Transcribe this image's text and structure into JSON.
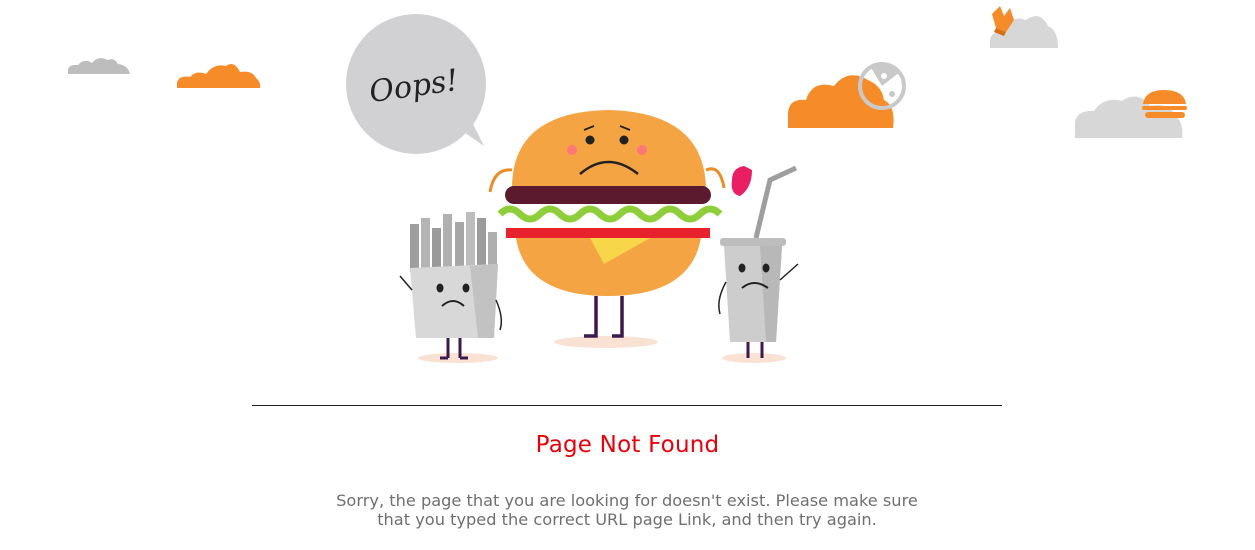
{
  "illustration": {
    "speech_text": "Oops!",
    "colors": {
      "orange": "#f68b2a",
      "grey_cloud": "#d7d7d7",
      "bubble": "#d1d1d3",
      "bun": "#f5a443",
      "patty": "#5b1a2d",
      "lettuce": "#8fce3b",
      "tomato": "#e8222c",
      "cheese": "#f7d64a",
      "cup": "#cdcdcd",
      "drop": "#ea1e63"
    },
    "icons": [
      "cloud-icon",
      "fries-icon",
      "pizza-icon",
      "burger-icon"
    ]
  },
  "error": {
    "title": "Page Not Found",
    "message_line1": "Sorry, the page that you are looking for doesn't exist. Please make sure",
    "message_line2": "that you typed the correct URL page Link, and then try again.",
    "title_color": "#e8000b",
    "text_color": "#6f6f6f"
  }
}
